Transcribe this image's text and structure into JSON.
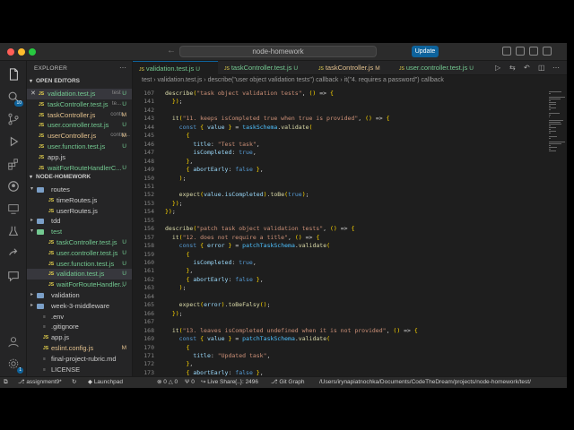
{
  "titlebar": {
    "search_text": "node-homework",
    "update_label": "Update",
    "back_icon": "arrow-left-icon",
    "forward_icon": "arrow-right-icon"
  },
  "colors": {
    "accent": "#0e639c",
    "modified": "#e2c08d",
    "untracked": "#73c991",
    "js": "#e8d44d",
    "keyword": "#569cd6",
    "string": "#ce9178",
    "func": "#dcdcaa",
    "var": "#9cdcfe",
    "const": "#4fc1ff"
  },
  "activity_bar": [
    {
      "icon": "files-icon"
    },
    {
      "icon": "search-icon",
      "badge": "10"
    },
    {
      "icon": "source-control-icon"
    },
    {
      "icon": "run-debug-icon"
    },
    {
      "icon": "extensions-icon"
    },
    {
      "icon": "github-icon"
    },
    {
      "icon": "remote-explorer-icon"
    },
    {
      "icon": "testing-icon"
    },
    {
      "icon": "live-share-icon"
    },
    {
      "icon": "chat-icon"
    }
  ],
  "activity_bottom": [
    {
      "icon": "account-icon"
    },
    {
      "icon": "settings-gear-icon",
      "badge": "1"
    }
  ],
  "sidebar": {
    "title": "EXPLORER",
    "open_editors_label": "OPEN EDITORS",
    "open_editors": [
      {
        "name": "validation.test.js",
        "hint": "test",
        "status": "U",
        "active": true
      },
      {
        "name": "taskController.test.js",
        "hint": "te...",
        "status": "U"
      },
      {
        "name": "taskController.js",
        "hint": "contr...",
        "status": "M"
      },
      {
        "name": "user.controller.test.js",
        "hint": "",
        "status": "U"
      },
      {
        "name": "userController.js",
        "hint": "contro...",
        "status": "M"
      },
      {
        "name": "user.function.test.js",
        "hint": "",
        "status": "U"
      },
      {
        "name": "app.js",
        "hint": "",
        "status": ""
      },
      {
        "name": "waitForRouteHandlerC...",
        "hint": "",
        "status": "U"
      }
    ],
    "project_label": "NODE-HOMEWORK",
    "tree": [
      {
        "name": "routes",
        "type": "folder",
        "depth": 1,
        "open": true
      },
      {
        "name": "timeRoutes.js",
        "type": "file",
        "depth": 2
      },
      {
        "name": "userRoutes.js",
        "type": "file",
        "depth": 2
      },
      {
        "name": "tdd",
        "type": "folder",
        "depth": 1,
        "open": false
      },
      {
        "name": "test",
        "type": "folder",
        "depth": 1,
        "open": true,
        "color": "untracked"
      },
      {
        "name": "taskController.test.js",
        "type": "file",
        "depth": 2,
        "status": "U"
      },
      {
        "name": "user.controller.test.js",
        "type": "file",
        "depth": 2,
        "status": "U"
      },
      {
        "name": "user.function.test.js",
        "type": "file",
        "depth": 2,
        "status": "U"
      },
      {
        "name": "validation.test.js",
        "type": "file",
        "depth": 2,
        "status": "U",
        "active": true
      },
      {
        "name": "waitForRouteHandler...",
        "type": "file",
        "depth": 2,
        "status": "U"
      },
      {
        "name": "validation",
        "type": "folder",
        "depth": 1,
        "open": false
      },
      {
        "name": "week-3-middleware",
        "type": "folder",
        "depth": 1,
        "open": false
      },
      {
        "name": ".env",
        "type": "other",
        "depth": 1
      },
      {
        "name": ".gitignore",
        "type": "other",
        "depth": 1
      },
      {
        "name": "app.js",
        "type": "file",
        "depth": 1
      },
      {
        "name": "eslint.config.js",
        "type": "file",
        "depth": 1,
        "status": "M"
      },
      {
        "name": "final-project-rubric.md",
        "type": "other",
        "depth": 1
      },
      {
        "name": "LICENSE",
        "type": "other",
        "depth": 1
      }
    ]
  },
  "tabs": [
    {
      "name": "validation.test.js",
      "status": "U",
      "active": true
    },
    {
      "name": "taskController.test.js",
      "status": "U"
    },
    {
      "name": "taskController.js",
      "status": "M"
    },
    {
      "name": "user.controller.test.js",
      "status": "U"
    }
  ],
  "breadcrumbs": [
    "test",
    "validation.test.js",
    "describe(\"user object validation tests\") callback",
    "it(\"4. requires a password\") callback"
  ],
  "code_lines": [
    {
      "n": "107",
      "t": "describe(\"task object validation tests\", () => {"
    },
    {
      "n": "141",
      "t": "  });"
    },
    {
      "n": "142",
      "t": ""
    },
    {
      "n": "143",
      "t": "  it(\"11. keeps isCompleted true when true is provided\", () => {"
    },
    {
      "n": "144",
      "t": "    const { value } = taskSchema.validate("
    },
    {
      "n": "145",
      "t": "      {"
    },
    {
      "n": "146",
      "t": "        title: \"Test task\","
    },
    {
      "n": "147",
      "t": "        isCompleted: true,"
    },
    {
      "n": "148",
      "t": "      },"
    },
    {
      "n": "149",
      "t": "      { abortEarly: false },"
    },
    {
      "n": "150",
      "t": "    );"
    },
    {
      "n": "151",
      "t": ""
    },
    {
      "n": "152",
      "t": "    expect(value.isCompleted).toBe(true);"
    },
    {
      "n": "153",
      "t": "  });"
    },
    {
      "n": "154",
      "t": "});"
    },
    {
      "n": "155",
      "t": ""
    },
    {
      "n": "156",
      "t": "describe(\"patch task object validation tests\", () => {"
    },
    {
      "n": "157",
      "t": "  it(\"12. does not require a title\", () => {"
    },
    {
      "n": "158",
      "t": "    const { error } = patchTaskSchema.validate("
    },
    {
      "n": "159",
      "t": "      {"
    },
    {
      "n": "160",
      "t": "        isCompleted: true,"
    },
    {
      "n": "161",
      "t": "      },"
    },
    {
      "n": "162",
      "t": "      { abortEarly: false },"
    },
    {
      "n": "163",
      "t": "    );"
    },
    {
      "n": "164",
      "t": ""
    },
    {
      "n": "165",
      "t": "    expect(error).toBeFalsy();"
    },
    {
      "n": "166",
      "t": "  });"
    },
    {
      "n": "167",
      "t": ""
    },
    {
      "n": "168",
      "t": "  it(\"13. leaves isCompleted undefined when it is not provided\", () => {"
    },
    {
      "n": "169",
      "t": "    const { value } = patchTaskSchema.validate("
    },
    {
      "n": "170",
      "t": "      {"
    },
    {
      "n": "171",
      "t": "        title: \"Updated task\","
    },
    {
      "n": "172",
      "t": "      },"
    },
    {
      "n": "173",
      "t": "      { abortEarly: false },"
    }
  ],
  "statusbar": {
    "branch": "assignment9*",
    "launchpad": "Launchpad",
    "errors": "0",
    "warnings": "0",
    "ports": "0",
    "live_share": "Live Share",
    "selection": "{..}: 2496",
    "git_graph": "Git Graph",
    "path": "/Users/irynapiatnochka/Documents/CodeTheDream/projects/node-homework/test/"
  }
}
